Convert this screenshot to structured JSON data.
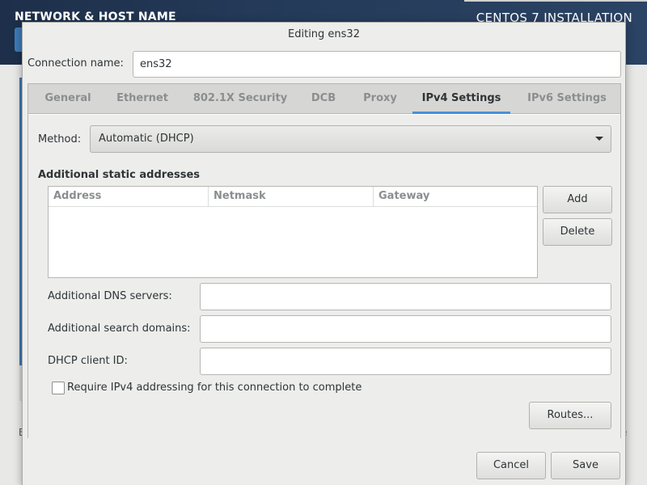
{
  "background": {
    "spoke_title": "NETWORK & HOST NAME",
    "product_title": "CENTOS 7 INSTALLATION",
    "partial_char_left": "E",
    "partial_char_right": "e"
  },
  "dialog": {
    "title": "Editing ens32",
    "connection_name_label": "Connection name:",
    "connection_name_value": "ens32"
  },
  "tabs": [
    {
      "label": "General",
      "active": false
    },
    {
      "label": "Ethernet",
      "active": false
    },
    {
      "label": "802.1X Security",
      "active": false
    },
    {
      "label": "DCB",
      "active": false
    },
    {
      "label": "Proxy",
      "active": false
    },
    {
      "label": "IPv4 Settings",
      "active": true
    },
    {
      "label": "IPv6 Settings",
      "active": false
    }
  ],
  "ipv4": {
    "method_label": "Method:",
    "method_value": "Automatic (DHCP)",
    "static_heading": "Additional static addresses",
    "columns": [
      "Address",
      "Netmask",
      "Gateway"
    ],
    "rows": [],
    "add_label": "Add",
    "delete_label": "Delete",
    "dns_label": "Additional DNS servers:",
    "dns_value": "",
    "search_label": "Additional search domains:",
    "search_value": "",
    "dhcp_label": "DHCP client ID:",
    "dhcp_value": "",
    "require_label": "Require IPv4 addressing for this connection to complete",
    "require_checked": false,
    "routes_label": "Routes..."
  },
  "footer": {
    "cancel_label": "Cancel",
    "save_label": "Save"
  },
  "colors": {
    "accent": "#4a90d9",
    "header_bg": "#243a58",
    "dialog_bg": "#ededec"
  }
}
